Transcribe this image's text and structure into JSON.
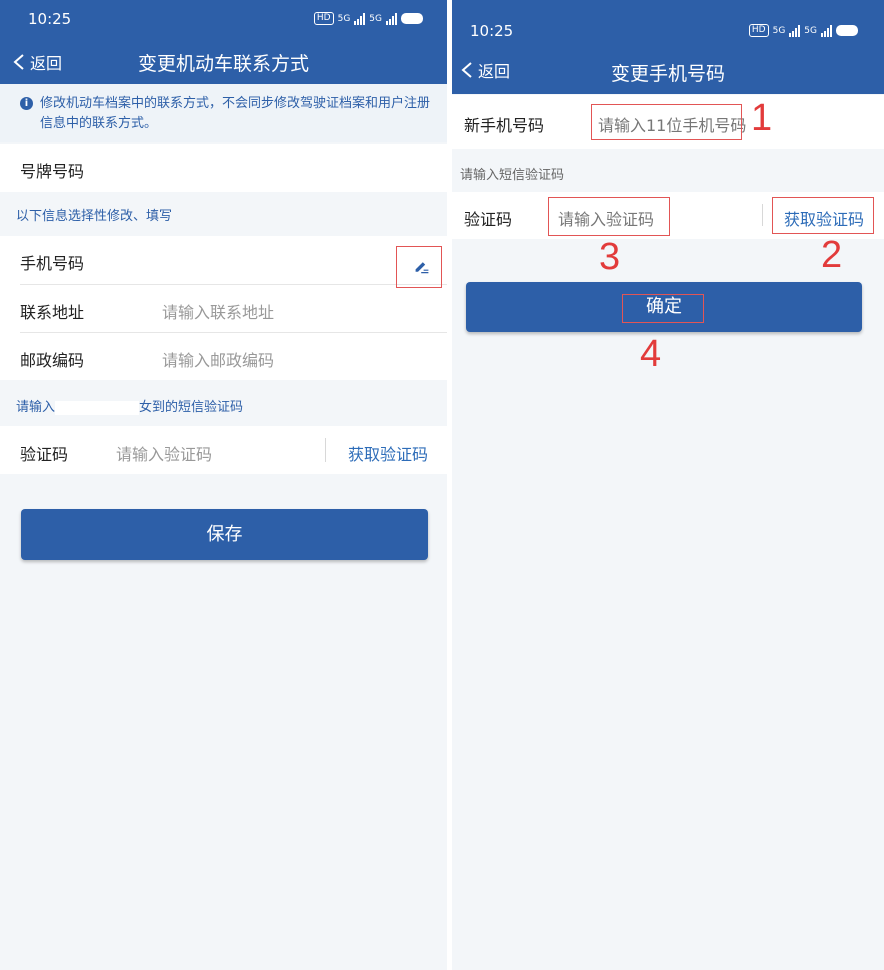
{
  "left": {
    "status": {
      "time": "10:25",
      "hd": "HD",
      "net1": "5G",
      "net2": "5G",
      "battery": "100"
    },
    "nav": {
      "back_label": "返回",
      "title": "变更机动车联系方式"
    },
    "notice": "修改机动车档案中的联系方式，不会同步修改驾驶证档案和用户注册信息中的联系方式。",
    "plate_label": "号牌号码",
    "optional_section": "以下信息选择性修改、填写",
    "phone_label": "手机号码",
    "address_label": "联系地址",
    "address_placeholder": "请输入联系地址",
    "postcode_label": "邮政编码",
    "postcode_placeholder": "请输入邮政编码",
    "sms_section_prefix": "请输入",
    "sms_section_suffix": "女到的短信验证码",
    "code_label": "验证码",
    "code_placeholder": "请输入验证码",
    "get_code": "获取验证码",
    "save_button": "保存"
  },
  "right": {
    "status": {
      "time": "10:25",
      "hd": "HD",
      "net1": "5G",
      "net2": "5G",
      "battery": "100"
    },
    "nav": {
      "back_label": "返回",
      "title": "变更手机号码"
    },
    "new_phone_label": "新手机号码",
    "new_phone_placeholder": "请输入11位手机号码",
    "sms_section": "请输入短信验证码",
    "code_label": "验证码",
    "code_placeholder": "请输入验证码",
    "get_code": "获取验证码",
    "confirm_button": "确定",
    "markers": [
      "1",
      "2",
      "3",
      "4"
    ]
  },
  "colors": {
    "brand_blue": "#2d5fa8",
    "annotation_red": "#e23b3b",
    "link_blue": "#2d6cb8"
  },
  "icons": [
    "chevron-left-icon",
    "info-icon",
    "edit-pencil-icon",
    "signal-icon",
    "battery-icon"
  ]
}
